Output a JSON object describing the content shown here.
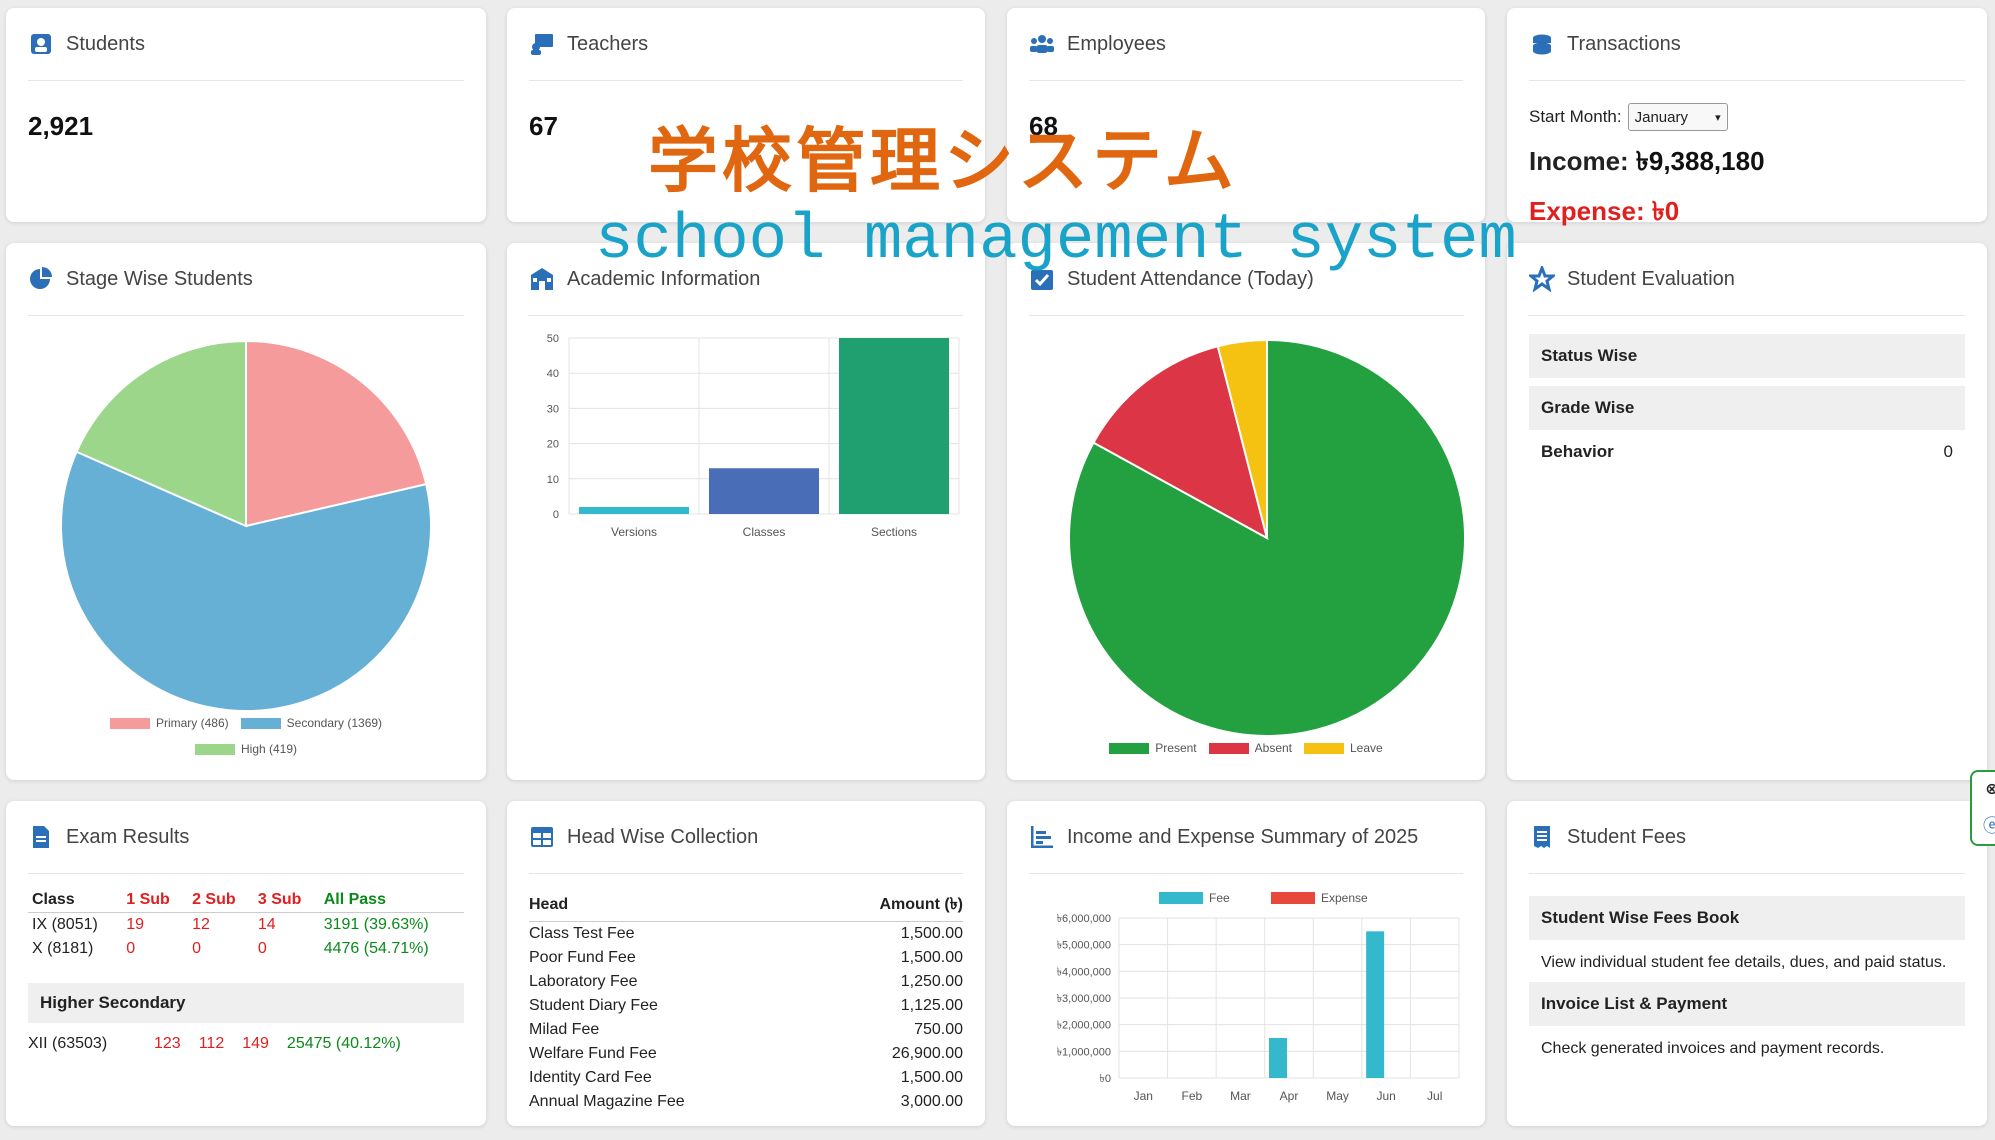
{
  "cards": {
    "students": {
      "title": "Students",
      "value": "2,921"
    },
    "teachers": {
      "title": "Teachers",
      "value": "67"
    },
    "employees": {
      "title": "Employees",
      "value": "68"
    },
    "transactions": {
      "title": "Transactions",
      "start_month_label": "Start Month:",
      "start_month_value": "January",
      "income_label": "Income:",
      "income_value": "৳9,388,180",
      "expense_label": "Expense:",
      "expense_value": "৳0"
    },
    "stage_wise": {
      "title": "Stage Wise Students"
    },
    "academic": {
      "title": "Academic Information"
    },
    "attendance": {
      "title": "Student Attendance (Today)"
    },
    "evaluation": {
      "title": "Student Evaluation",
      "items": [
        "Status Wise",
        "Grade Wise"
      ],
      "behavior_label": "Behavior",
      "behavior_value": "0"
    },
    "exam": {
      "title": "Exam Results",
      "headers": [
        "Class",
        "1 Sub",
        "2 Sub",
        "3 Sub",
        "All Pass"
      ],
      "rows": [
        [
          "IX (8051)",
          "19",
          "12",
          "14",
          "3191 (39.63%)"
        ],
        [
          "X (8181)",
          "0",
          "0",
          "0",
          "4476 (54.71%)"
        ]
      ],
      "section_title": "Higher Secondary",
      "section_rows": [
        [
          "XII (63503)",
          "123",
          "112",
          "149",
          "25475 (40.12%)"
        ]
      ]
    },
    "head_wise": {
      "title": "Head Wise Collection",
      "head_header": "Head",
      "amount_header": "Amount (৳)",
      "rows": [
        [
          "Class Test Fee",
          "1,500.00"
        ],
        [
          "Poor Fund Fee",
          "1,500.00"
        ],
        [
          "Laboratory Fee",
          "1,250.00"
        ],
        [
          "Student Diary Fee",
          "1,125.00"
        ],
        [
          "Milad Fee",
          "750.00"
        ],
        [
          "Welfare Fund Fee",
          "26,900.00"
        ],
        [
          "Identity Card Fee",
          "1,500.00"
        ],
        [
          "Annual Magazine Fee",
          "3,000.00"
        ]
      ]
    },
    "income_summary": {
      "title": "Income and Expense Summary of 2025"
    },
    "student_fees": {
      "title": "Student Fees",
      "item1_title": "Student Wise Fees Book",
      "item1_desc": "View individual student fee details, dues, and paid status.",
      "item2_title": "Invoice List & Payment",
      "item2_desc": "Check generated invoices and payment records."
    }
  },
  "overlay": {
    "jp": "学校管理システム",
    "en": "school management system"
  },
  "chart_data": [
    {
      "type": "pie",
      "labels": [
        "Primary (486)",
        "Secondary (1369)",
        "High (419)"
      ],
      "values": [
        486,
        1369,
        419
      ],
      "colors": [
        "#f59b9b",
        "#66b0d6",
        "#9bd68b"
      ]
    },
    {
      "type": "bar",
      "categories": [
        "Versions",
        "Classes",
        "Sections"
      ],
      "values": [
        2,
        13,
        50
      ],
      "colors": [
        "#33b8cc",
        "#4a6db8",
        "#20a070"
      ],
      "ylim": [
        0,
        50
      ],
      "yticks": [
        0,
        10,
        20,
        30,
        40,
        50
      ],
      "grid": true
    },
    {
      "type": "pie",
      "labels": [
        "Present",
        "Absent",
        "Leave"
      ],
      "values": [
        83,
        13,
        4
      ],
      "colors": [
        "#23a03f",
        "#dc3545",
        "#f5c211"
      ]
    },
    {
      "type": "bar",
      "categories": [
        "Jan",
        "Feb",
        "Mar",
        "Apr",
        "May",
        "Jun",
        "Jul"
      ],
      "series": [
        {
          "name": "Fee",
          "values": [
            0,
            0,
            0,
            1500000,
            0,
            5500000,
            0
          ],
          "color": "#33b8cc"
        },
        {
          "name": "Expense",
          "values": [
            0,
            0,
            0,
            0,
            0,
            0,
            0
          ],
          "color": "#e8473c"
        }
      ],
      "ylim": [
        0,
        6000000
      ],
      "ytick_labels": [
        "৳0",
        "৳1,000,000",
        "৳2,000,000",
        "৳3,000,000",
        "৳4,000,000",
        "৳5,000,000",
        "৳6,000,000"
      ],
      "grid": true,
      "legend": "top"
    }
  ]
}
